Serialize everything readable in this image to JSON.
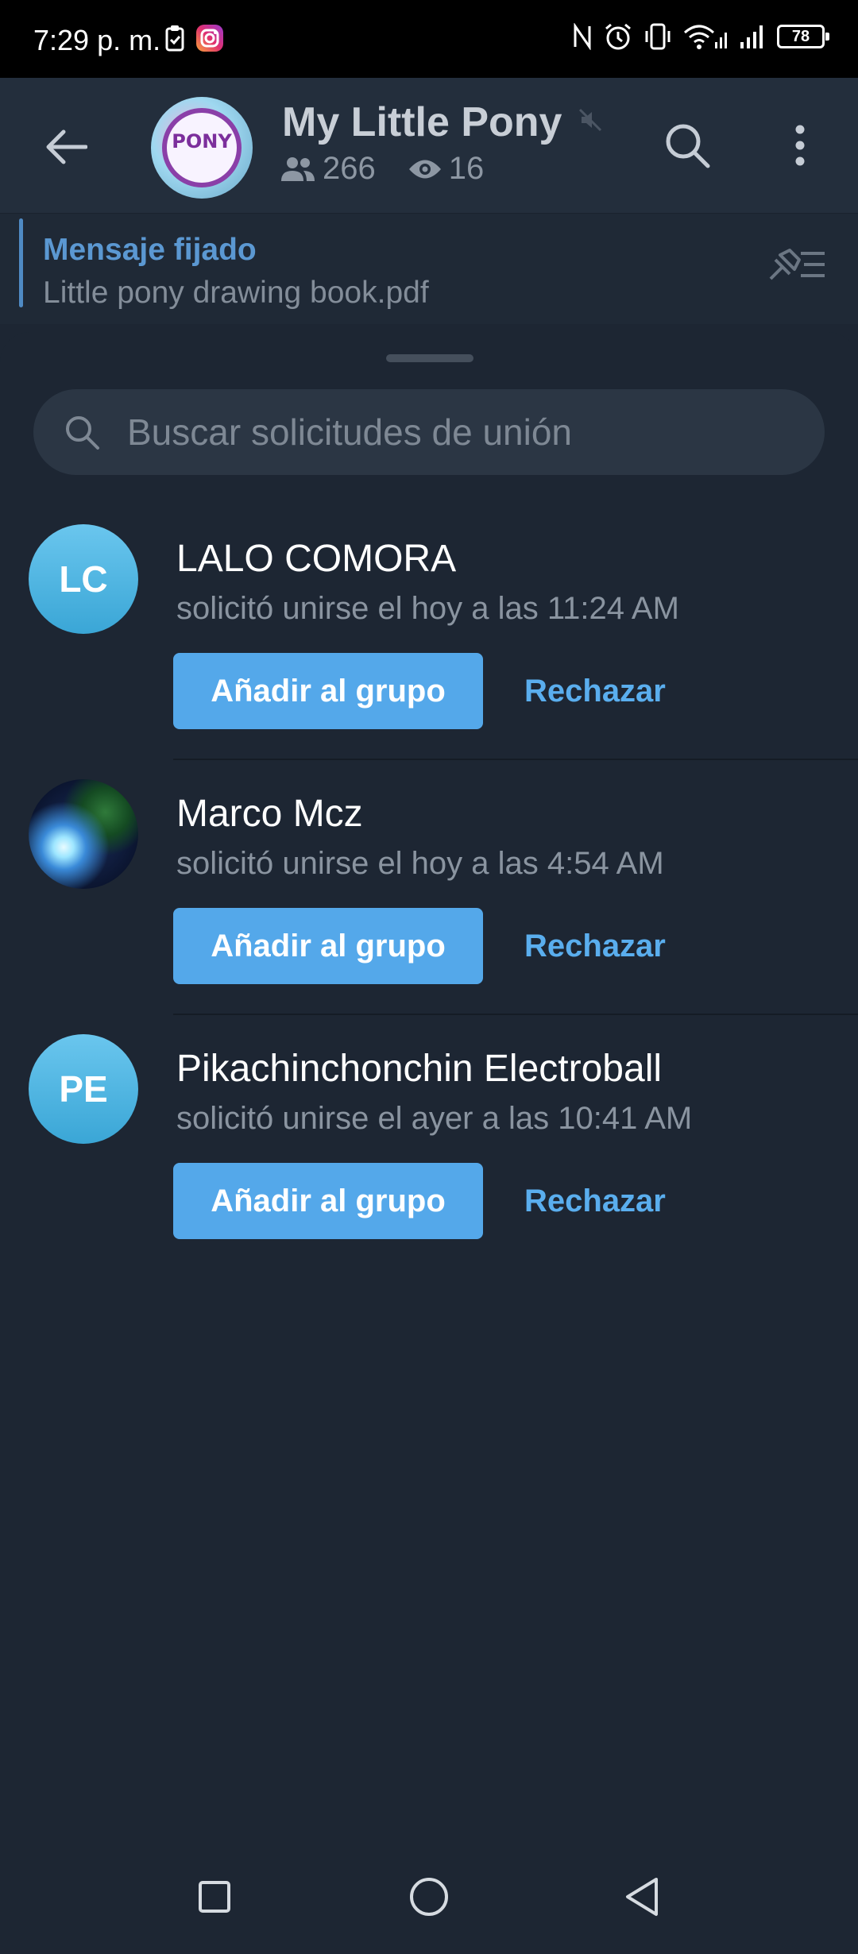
{
  "status_bar": {
    "time": "7:29 p. m.",
    "battery": "78",
    "icons": [
      "clipboard-icon",
      "instagram-icon",
      "nfc-icon",
      "alarm-icon",
      "vibrate-icon",
      "wifi-icon",
      "signal-icon",
      "signal-icon-2",
      "battery-icon"
    ]
  },
  "header": {
    "title": "My Little Pony",
    "avatar_text": "PONY",
    "members": "266",
    "online": "16",
    "icons": [
      "back-arrow-icon",
      "mute-icon",
      "search-icon",
      "more-vertical-icon"
    ]
  },
  "pinned": {
    "title": "Mensaje fijado",
    "text": "Little pony drawing book.pdf"
  },
  "search": {
    "placeholder": "Buscar solicitudes de unión"
  },
  "requests": [
    {
      "initials": "LC",
      "name": "LALO COMORA",
      "time": "solicitó unirse el hoy a las 11:24 AM",
      "add_label": "Añadir al grupo",
      "reject_label": "Rechazar"
    },
    {
      "initials": "",
      "name": "Marco Mcz",
      "time": "solicitó unirse el hoy a las 4:54 AM",
      "add_label": "Añadir al grupo",
      "reject_label": "Rechazar"
    },
    {
      "initials": "PE",
      "name": "Pikachinchonchin Electroball",
      "time": "solicitó unirse el ayer a las 10:41 AM",
      "add_label": "Añadir al grupo",
      "reject_label": "Rechazar"
    }
  ],
  "colors": {
    "background": "#1d2633",
    "header": "#232e3c",
    "accent": "#54a8ea",
    "link": "#5aaeee",
    "avatar_blue": "#3aa6d6"
  }
}
